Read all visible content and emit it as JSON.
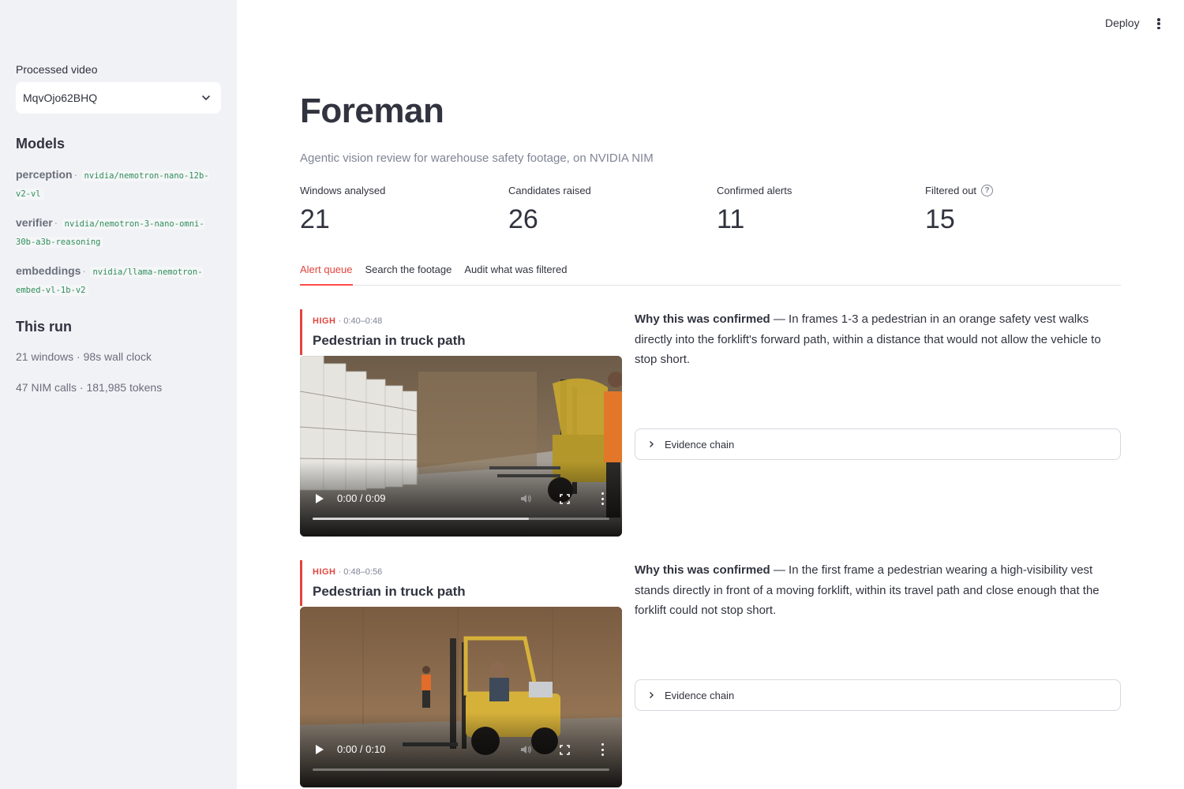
{
  "sidebar": {
    "video_label": "Processed video",
    "video_selected": "MqvOjo62BHQ",
    "models_heading": "Models",
    "models": [
      {
        "role": "perception",
        "separator": "·",
        "model": "nvidia/nemotron-nano-12b-v2-vl"
      },
      {
        "role": "verifier",
        "separator": "·",
        "model": "nvidia/nemotron-3-nano-omni-30b-a3b-reasoning"
      },
      {
        "role": "embeddings",
        "separator": "·",
        "model": "nvidia/llama-nemotron-embed-vl-1b-v2"
      }
    ],
    "run_heading": "This run",
    "run_stats": [
      "21 windows · 98s wall clock",
      "47 NIM calls · 181,985 tokens"
    ]
  },
  "header": {
    "deploy_label": "Deploy",
    "menu_icon": "more-vertical-icon"
  },
  "main": {
    "title": "Foreman",
    "subtitle": "Agentic vision review for warehouse safety footage, on NVIDIA NIM",
    "metrics": [
      {
        "label": "Windows analysed",
        "value": "21"
      },
      {
        "label": "Candidates raised",
        "value": "26"
      },
      {
        "label": "Confirmed alerts",
        "value": "11"
      },
      {
        "label": "Filtered out",
        "value": "15",
        "help_icon": "?"
      }
    ],
    "tabs": [
      {
        "label": "Alert queue",
        "active": true
      },
      {
        "label": "Search the footage",
        "active": false
      },
      {
        "label": "Audit what was filtered",
        "active": false
      }
    ],
    "alerts": [
      {
        "severity": "HIGH",
        "time_range": "· 0:40–0:48",
        "title": "Pedestrian in truck path",
        "video_time": "0:00 / 0:09",
        "buffered": 0.73,
        "why_label": "Why this was confirmed",
        "why_text": " — In frames 1-3 a pedestrian in an orange safety vest walks directly into the forklift's forward path, within a distance that would not allow the vehicle to stop short.",
        "expander_label": "Evidence chain"
      },
      {
        "severity": "HIGH",
        "time_range": "· 0:48–0:56",
        "title": "Pedestrian in truck path",
        "video_time": "0:00 / 0:10",
        "buffered": 0.0,
        "why_label": "Why this was confirmed",
        "why_text": " — In the first frame a pedestrian wearing a high-visibility vest stands directly in front of a moving forklift, within its travel path and close enough that the forklift could not stop short.",
        "expander_label": "Evidence chain"
      }
    ]
  },
  "colors": {
    "sidebar_bg": "#f0f2f6",
    "accent_red": "#e0453f",
    "text": "#31333f",
    "muted": "#808495",
    "code_green": "#2f8e5a"
  }
}
